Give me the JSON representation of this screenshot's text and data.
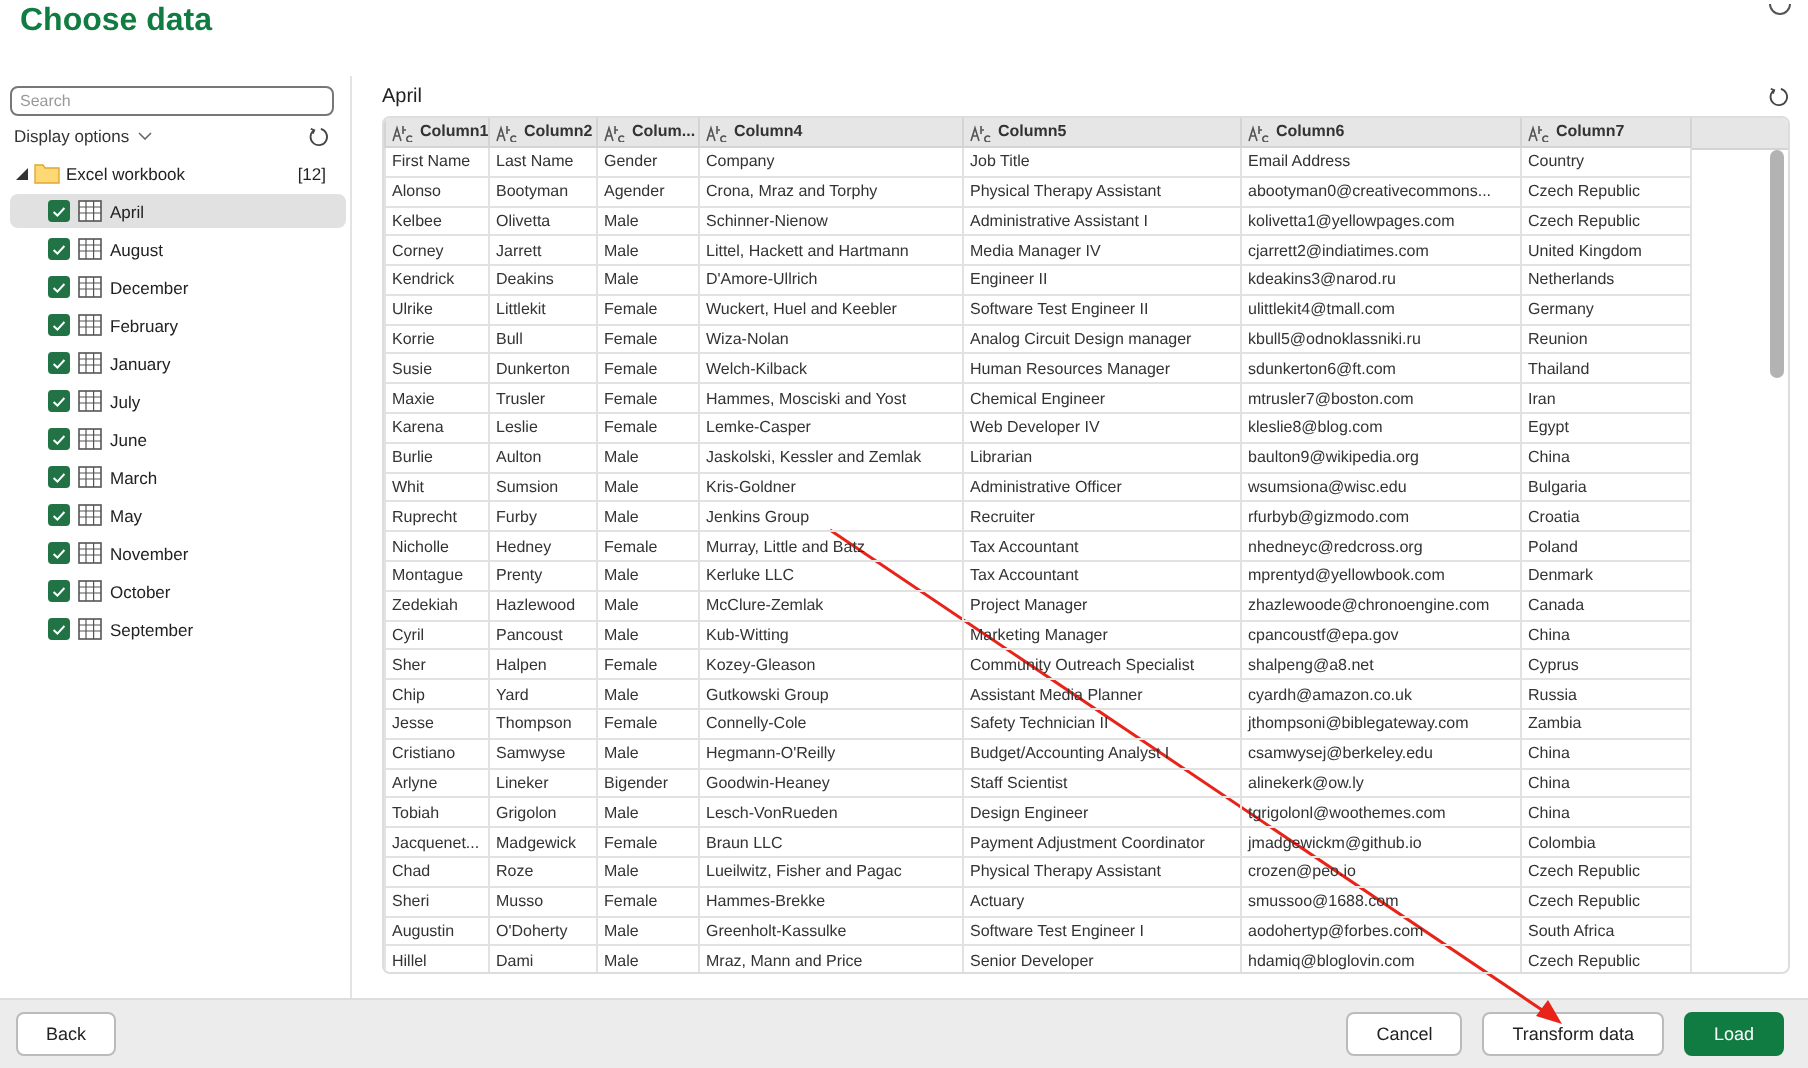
{
  "title": "Choose data",
  "sidebar": {
    "search": {
      "placeholder": "Search"
    },
    "display_options": "Display options",
    "tree": {
      "label": "Excel workbook",
      "count": "[12]",
      "expanded": true,
      "children": [
        {
          "label": "April",
          "checked": true,
          "selected": true
        },
        {
          "label": "August",
          "checked": true,
          "selected": false
        },
        {
          "label": "December",
          "checked": true,
          "selected": false
        },
        {
          "label": "February",
          "checked": true,
          "selected": false
        },
        {
          "label": "January",
          "checked": true,
          "selected": false
        },
        {
          "label": "July",
          "checked": true,
          "selected": false
        },
        {
          "label": "June",
          "checked": true,
          "selected": false
        },
        {
          "label": "March",
          "checked": true,
          "selected": false
        },
        {
          "label": "May",
          "checked": true,
          "selected": false
        },
        {
          "label": "November",
          "checked": true,
          "selected": false
        },
        {
          "label": "October",
          "checked": true,
          "selected": false
        },
        {
          "label": "September",
          "checked": true,
          "selected": false
        }
      ]
    }
  },
  "preview": {
    "title": "April",
    "table": {
      "columns": [
        "Column1",
        "Column2",
        "Colum...",
        "Column4",
        "Column5",
        "Column6",
        "Column7"
      ],
      "rows": [
        [
          "First Name",
          "Last Name",
          "Gender",
          "Company",
          "Job Title",
          "Email Address",
          "Country"
        ],
        [
          "Alonso",
          "Bootyman",
          "Agender",
          "Crona, Mraz and Torphy",
          "Physical Therapy Assistant",
          "abootyman0@creativecommons...",
          "Czech Republic"
        ],
        [
          "Kelbee",
          "Olivetta",
          "Male",
          "Schinner-Nienow",
          "Administrative Assistant I",
          "kolivetta1@yellowpages.com",
          "Czech Republic"
        ],
        [
          "Corney",
          "Jarrett",
          "Male",
          "Littel, Hackett and Hartmann",
          "Media Manager IV",
          "cjarrett2@indiatimes.com",
          "United Kingdom"
        ],
        [
          "Kendrick",
          "Deakins",
          "Male",
          "D'Amore-Ullrich",
          "Engineer II",
          "kdeakins3@narod.ru",
          "Netherlands"
        ],
        [
          "Ulrike",
          "Littlekit",
          "Female",
          "Wuckert, Huel and Keebler",
          "Software Test Engineer II",
          "ulittlekit4@tmall.com",
          "Germany"
        ],
        [
          "Korrie",
          "Bull",
          "Female",
          "Wiza-Nolan",
          "Analog Circuit Design manager",
          "kbull5@odnoklassniki.ru",
          "Reunion"
        ],
        [
          "Susie",
          "Dunkerton",
          "Female",
          "Welch-Kilback",
          "Human Resources Manager",
          "sdunkerton6@ft.com",
          "Thailand"
        ],
        [
          "Maxie",
          "Trusler",
          "Female",
          "Hammes, Mosciski and Yost",
          "Chemical Engineer",
          "mtrusler7@boston.com",
          "Iran"
        ],
        [
          "Karena",
          "Leslie",
          "Female",
          "Lemke-Casper",
          "Web Developer IV",
          "kleslie8@blog.com",
          "Egypt"
        ],
        [
          "Burlie",
          "Aulton",
          "Male",
          "Jaskolski, Kessler and Zemlak",
          "Librarian",
          "baulton9@wikipedia.org",
          "China"
        ],
        [
          "Whit",
          "Sumsion",
          "Male",
          "Kris-Goldner",
          "Administrative Officer",
          "wsumsiona@wisc.edu",
          "Bulgaria"
        ],
        [
          "Ruprecht",
          "Furby",
          "Male",
          "Jenkins Group",
          "Recruiter",
          "rfurbyb@gizmodo.com",
          "Croatia"
        ],
        [
          "Nicholle",
          "Hedney",
          "Female",
          "Murray, Little and Batz",
          "Tax Accountant",
          "nhedneyc@redcross.org",
          "Poland"
        ],
        [
          "Montague",
          "Prenty",
          "Male",
          "Kerluke LLC",
          "Tax Accountant",
          "mprentyd@yellowbook.com",
          "Denmark"
        ],
        [
          "Zedekiah",
          "Hazlewood",
          "Male",
          "McClure-Zemlak",
          "Project Manager",
          "zhazlewoode@chronoengine.com",
          "Canada"
        ],
        [
          "Cyril",
          "Pancoust",
          "Male",
          "Kub-Witting",
          "Marketing Manager",
          "cpancoustf@epa.gov",
          "China"
        ],
        [
          "Sher",
          "Halpen",
          "Female",
          "Kozey-Gleason",
          "Community Outreach Specialist",
          "shalpeng@a8.net",
          "Cyprus"
        ],
        [
          "Chip",
          "Yard",
          "Male",
          "Gutkowski Group",
          "Assistant Media Planner",
          "cyardh@amazon.co.uk",
          "Russia"
        ],
        [
          "Jesse",
          "Thompson",
          "Female",
          "Connelly-Cole",
          "Safety Technician II",
          "jthompsoni@biblegateway.com",
          "Zambia"
        ],
        [
          "Cristiano",
          "Samwyse",
          "Male",
          "Hegmann-O'Reilly",
          "Budget/Accounting Analyst I",
          "csamwysej@berkeley.edu",
          "China"
        ],
        [
          "Arlyne",
          "Lineker",
          "Bigender",
          "Goodwin-Heaney",
          "Staff Scientist",
          "alinekerk@ow.ly",
          "China"
        ],
        [
          "Tobiah",
          "Grigolon",
          "Male",
          "Lesch-VonRueden",
          "Design Engineer",
          "tgrigolonl@woothemes.com",
          "China"
        ],
        [
          "Jacquenet...",
          "Madgewick",
          "Female",
          "Braun LLC",
          "Payment Adjustment Coordinator",
          "jmadgewickm@github.io",
          "Colombia"
        ],
        [
          "Chad",
          "Roze",
          "Male",
          "Lueilwitz, Fisher and Pagac",
          "Physical Therapy Assistant",
          "crozen@peo.io",
          "Czech Republic"
        ],
        [
          "Sheri",
          "Musso",
          "Female",
          "Hammes-Brekke",
          "Actuary",
          "smussoo@1688.com",
          "Czech Republic"
        ],
        [
          "Augustin",
          "O'Doherty",
          "Male",
          "Greenholt-Kassulke",
          "Software Test Engineer I",
          "aodohertyp@forbes.com",
          "South Africa"
        ],
        [
          "Hillel",
          "Dami",
          "Male",
          "Mraz, Mann and Price",
          "Senior Developer",
          "hdamiq@bloglovin.com",
          "Czech Republic"
        ]
      ]
    }
  },
  "footer": {
    "back": "Back",
    "cancel": "Cancel",
    "transform": "Transform data",
    "load": "Load"
  }
}
